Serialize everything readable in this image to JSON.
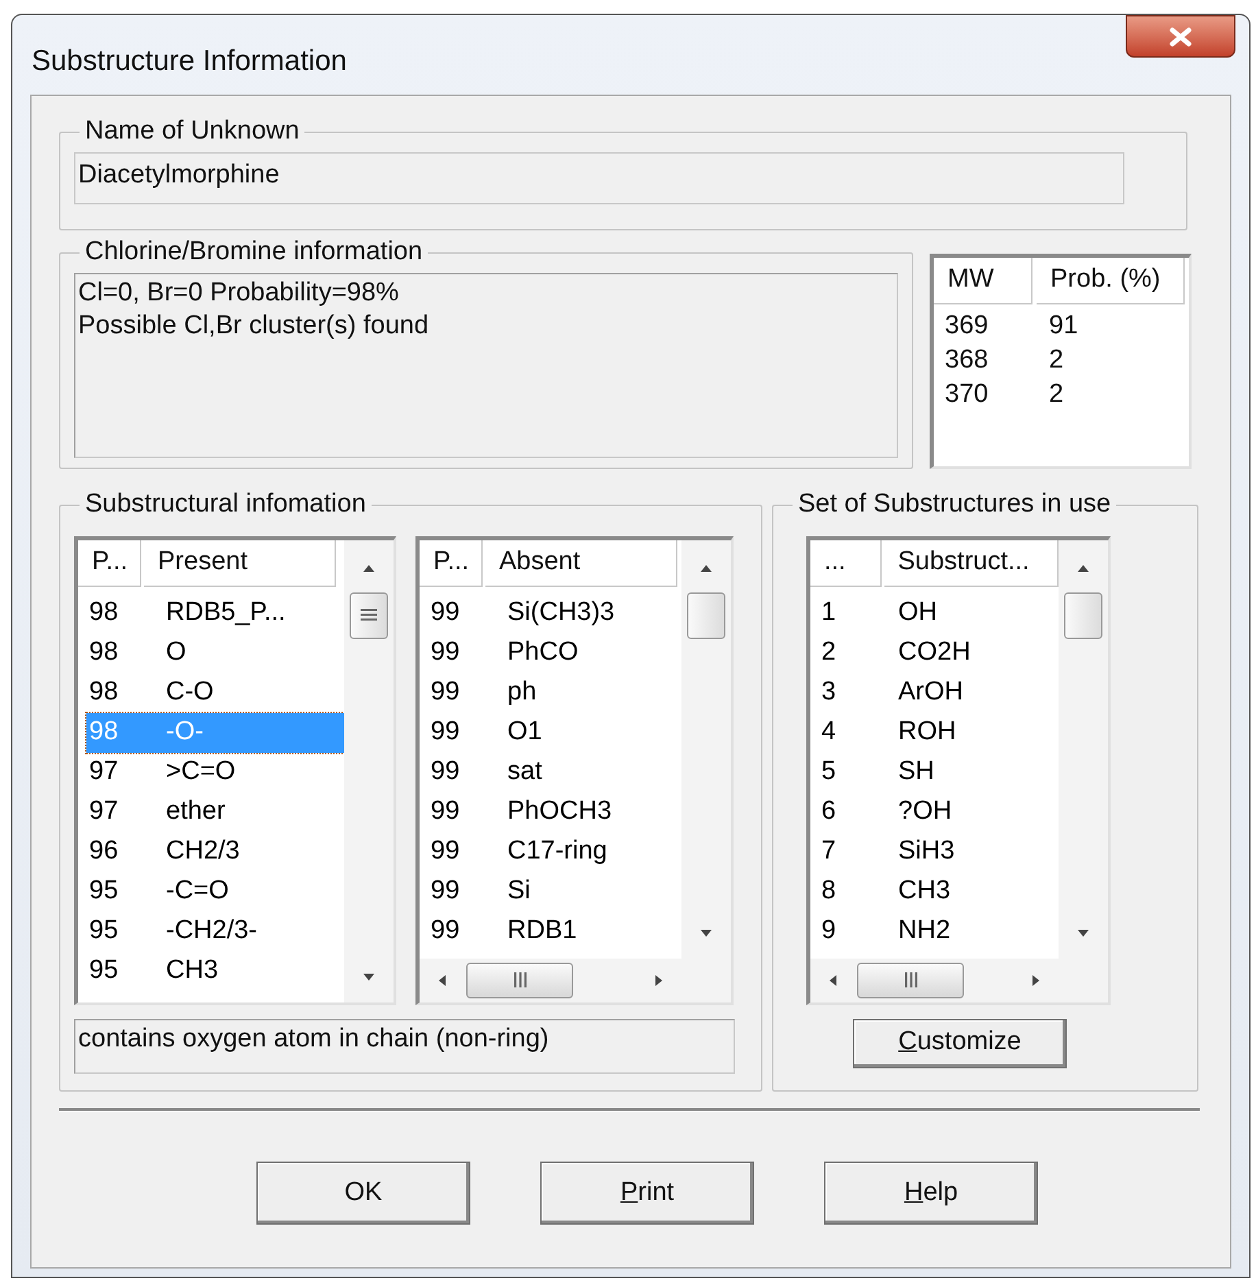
{
  "window": {
    "title": "Substructure Information"
  },
  "name_of_unknown": {
    "label": "Name of Unknown",
    "value": "Diacetylmorphine"
  },
  "chlorine_bromine": {
    "label": "Chlorine/Bromine information",
    "lines": [
      "Cl=0, Br=0 Probability=98%",
      "Possible Cl,Br cluster(s) found"
    ]
  },
  "mw_table": {
    "columns": [
      "MW",
      "Prob. (%)"
    ],
    "rows": [
      {
        "cells": [
          "369",
          "91"
        ]
      },
      {
        "cells": [
          "368",
          "2"
        ]
      },
      {
        "cells": [
          "370",
          "2"
        ]
      }
    ]
  },
  "substructural": {
    "label": "Substructural infomation",
    "present": {
      "columns": [
        "P...",
        "Present"
      ],
      "rows": [
        {
          "cells": [
            "98",
            "RDB5_P..."
          ],
          "selected": false
        },
        {
          "cells": [
            "98",
            "O"
          ],
          "selected": false
        },
        {
          "cells": [
            "98",
            "C-O"
          ],
          "selected": false
        },
        {
          "cells": [
            "98",
            "-O-"
          ],
          "selected": true
        },
        {
          "cells": [
            "97",
            ">C=O"
          ],
          "selected": false
        },
        {
          "cells": [
            "97",
            "ether"
          ],
          "selected": false
        },
        {
          "cells": [
            "96",
            "CH2/3"
          ],
          "selected": false
        },
        {
          "cells": [
            "95",
            "-C=O"
          ],
          "selected": false
        },
        {
          "cells": [
            "95",
            "-CH2/3-"
          ],
          "selected": false
        },
        {
          "cells": [
            "95",
            "CH3"
          ],
          "selected": false
        }
      ]
    },
    "absent": {
      "columns": [
        "P...",
        "Absent"
      ],
      "rows": [
        {
          "cells": [
            "99",
            "Si(CH3)3"
          ],
          "selected": false
        },
        {
          "cells": [
            "99",
            "PhCO"
          ],
          "selected": false
        },
        {
          "cells": [
            "99",
            "ph"
          ],
          "selected": false
        },
        {
          "cells": [
            "99",
            "O1"
          ],
          "selected": false
        },
        {
          "cells": [
            "99",
            "sat"
          ],
          "selected": false
        },
        {
          "cells": [
            "99",
            "PhOCH3"
          ],
          "selected": false
        },
        {
          "cells": [
            "99",
            "C17-ring"
          ],
          "selected": false
        },
        {
          "cells": [
            "99",
            "Si"
          ],
          "selected": false
        },
        {
          "cells": [
            "99",
            "RDB1"
          ],
          "selected": false
        }
      ]
    },
    "description": "contains oxygen atom in chain (non-ring)"
  },
  "substructure_set": {
    "label": "Set of Substructures in use",
    "list": {
      "columns": [
        "...",
        "Substruct..."
      ],
      "rows": [
        {
          "cells": [
            "1",
            "OH"
          ],
          "selected": false
        },
        {
          "cells": [
            "2",
            "CO2H"
          ],
          "selected": false
        },
        {
          "cells": [
            "3",
            "ArOH"
          ],
          "selected": false
        },
        {
          "cells": [
            "4",
            "ROH"
          ],
          "selected": false
        },
        {
          "cells": [
            "5",
            "SH"
          ],
          "selected": false
        },
        {
          "cells": [
            "6",
            "?OH"
          ],
          "selected": false
        },
        {
          "cells": [
            "7",
            "SiH3"
          ],
          "selected": false
        },
        {
          "cells": [
            "8",
            "CH3"
          ],
          "selected": false
        },
        {
          "cells": [
            "9",
            "NH2"
          ],
          "selected": false
        }
      ]
    },
    "customize_button": {
      "label": "Customize",
      "access_key_underlined": true
    }
  },
  "buttons": [
    {
      "label": "OK",
      "access_key_underlined": false
    },
    {
      "label": "Print",
      "access_key_underlined": true
    },
    {
      "label": "Help",
      "access_key_underlined": true
    }
  ]
}
